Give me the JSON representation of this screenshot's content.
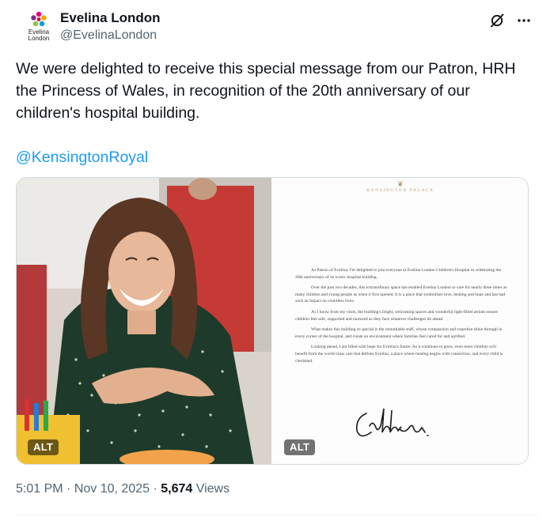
{
  "author": {
    "display_name": "Evelina London",
    "handle": "@EvelinaLondon",
    "avatar_wordmark": "Evelina\nLondon"
  },
  "tweet": {
    "text": "We were delighted to receive this special message from our Patron, HRH the Princess of Wales, in recognition of the 20th anniversary of our children's hospital building.",
    "mention": "@KensingtonRoyal"
  },
  "media": {
    "photo_alt_label": "ALT",
    "letter_alt_label": "ALT",
    "letter": {
      "heading": "KENSINGTON PALACE",
      "paragraphs": [
        "As Patron of Evelina, I'm delighted to join everyone at Evelina London Children's Hospital in celebrating the 20th anniversary of its iconic hospital building.",
        "Over the past two decades, this extraordinary space has enabled Evelina London to care for nearly three times as many children and young people as when it first opened. It is a place that symbolises love, healing and hope and has had such an impact on countless lives.",
        "As I know from my visits, the building's bright, welcoming spaces and wonderful light-filled atrium ensure children feel safe, supported and nurtured as they face whatever challenges lie ahead.",
        "What makes this building so special is the remarkable staff, whose compassion and expertise shine through in every corner of the hospital, and create an environment where families feel cared for and uplifted.",
        "Looking ahead, I am filled with hope for Evelina's future. As it continues to grow, even more children will benefit from the world-class care that defines Evelina, a place where healing begins with connection, and every child is cherished."
      ]
    }
  },
  "meta": {
    "time": "5:01 PM",
    "separator": " · ",
    "date": "Nov 10, 2025",
    "views_count": "5,674",
    "views_label": " Views"
  },
  "icons": {
    "grok": "grok-icon",
    "more": "more-icon",
    "logo": "evelina-logo-icon"
  },
  "colors": {
    "link": "#1d9bf0",
    "secondary_text": "#536471",
    "primary_text": "#0f1419",
    "border": "#cfd9de"
  }
}
